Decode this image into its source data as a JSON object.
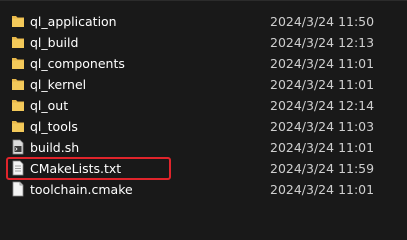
{
  "files": [
    {
      "name": "ql_application",
      "modified": "2024/3/24 11:50",
      "icon": "folder-icon"
    },
    {
      "name": "ql_build",
      "modified": "2024/3/24 12:13",
      "icon": "folder-icon"
    },
    {
      "name": "ql_components",
      "modified": "2024/3/24 11:01",
      "icon": "folder-icon"
    },
    {
      "name": "ql_kernel",
      "modified": "2024/3/24 11:01",
      "icon": "folder-icon"
    },
    {
      "name": "ql_out",
      "modified": "2024/3/24 12:14",
      "icon": "folder-icon"
    },
    {
      "name": "ql_tools",
      "modified": "2024/3/24 11:03",
      "icon": "folder-icon"
    },
    {
      "name": "build.sh",
      "modified": "2024/3/24 11:01",
      "icon": "shell-script-icon"
    },
    {
      "name": "CMakeLists.txt",
      "modified": "2024/3/24 11:59",
      "icon": "text-file-icon"
    },
    {
      "name": "toolchain.cmake",
      "modified": "2024/3/24 11:01",
      "icon": "file-icon"
    }
  ],
  "colors": {
    "background": "#191919",
    "folder": "#e8b84a",
    "highlight_border": "#e0242b"
  }
}
